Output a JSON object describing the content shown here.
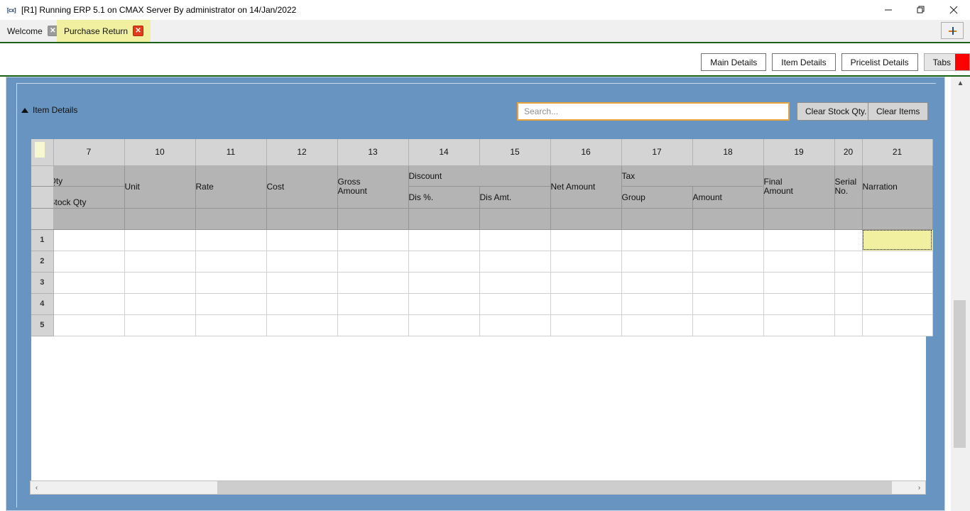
{
  "window": {
    "title": "[R1] Running ERP 5.1 on CMAX Server By administrator on 14/Jan/2022",
    "app_icon": "cmax-icon",
    "minimize_label": "—",
    "restore_label": "❐",
    "close_label": "✕"
  },
  "tabs": {
    "items": [
      {
        "label": "Welcome",
        "close": "✕",
        "active": false
      },
      {
        "label": "Purchase Return",
        "close": "✕",
        "active": true
      }
    ],
    "add_tab_label": "+"
  },
  "toolbar": {
    "buttons": [
      {
        "label": "Main Details",
        "active": false
      },
      {
        "label": "Item Details",
        "active": false
      },
      {
        "label": "Pricelist Details",
        "active": false
      },
      {
        "label": "Tabs",
        "active": true
      }
    ]
  },
  "section": {
    "title": "Item Details",
    "collapse_caret": "▲"
  },
  "search": {
    "placeholder": "Search...",
    "value": ""
  },
  "actions": {
    "clear_stock_qty": "Clear Stock Qty.",
    "clear_items": "Clear Items"
  },
  "grid": {
    "column_numbers": [
      "7",
      "10",
      "11",
      "12",
      "13",
      "14",
      "15",
      "16",
      "17",
      "18",
      "19",
      "20",
      "21"
    ],
    "group_headers": [
      {
        "label": "Qty",
        "span": 1
      },
      {
        "label": "Unit",
        "span": 1
      },
      {
        "label": "Rate",
        "span": 1
      },
      {
        "label": "Cost",
        "span": 1
      },
      {
        "label": "Gross Amount",
        "span": 1
      },
      {
        "label": "Discount",
        "span": 2
      },
      {
        "label": "Net Amount",
        "span": 1
      },
      {
        "label": "Tax",
        "span": 2
      },
      {
        "label": "Final Amount",
        "span": 1
      },
      {
        "label": "Serial No.",
        "span": 1
      },
      {
        "label": "Narration",
        "span": 1
      }
    ],
    "sub_headers": {
      "qty": "Stock Qty",
      "discount_pct": "Dis %.",
      "discount_amt": "Dis Amt.",
      "tax_group": "Group",
      "tax_amount": "Amount"
    },
    "header_cells": {
      "qty": "Qty",
      "unit": "Unit",
      "rate": "Rate",
      "cost": "Cost",
      "gross_amount_l1": "Gross",
      "gross_amount_l2": "Amount",
      "discount": "Discount",
      "net_amount": "Net Amount",
      "tax": "Tax",
      "final_amount_l1": "Final",
      "final_amount_l2": "Amount",
      "serial_no_l1": "Serial",
      "serial_no_l2": "No.",
      "narration": "Narration"
    },
    "row_numbers": [
      "1",
      "2",
      "3",
      "4",
      "5"
    ],
    "rows": [
      {
        "n": "1",
        "cells": [
          "",
          "",
          "",
          "",
          "",
          "",
          "",
          "",
          "",
          "",
          "",
          "",
          ""
        ]
      },
      {
        "n": "2",
        "cells": [
          "",
          "",
          "",
          "",
          "",
          "",
          "",
          "",
          "",
          "",
          "",
          "",
          ""
        ]
      },
      {
        "n": "3",
        "cells": [
          "",
          "",
          "",
          "",
          "",
          "",
          "",
          "",
          "",
          "",
          "",
          "",
          ""
        ]
      },
      {
        "n": "4",
        "cells": [
          "",
          "",
          "",
          "",
          "",
          "",
          "",
          "",
          "",
          "",
          "",
          "",
          ""
        ]
      },
      {
        "n": "5",
        "cells": [
          "",
          "",
          "",
          "",
          "",
          "",
          "",
          "",
          "",
          "",
          "",
          "",
          ""
        ]
      }
    ],
    "selected_cell": {
      "row": "1",
      "column": "21",
      "column_label": "Narration",
      "value": ""
    }
  },
  "scrollbars": {
    "h_left_arrow": "‹",
    "h_right_arrow": "›",
    "v_up_arrow": "▲"
  },
  "colors": {
    "panel_blue": "#6794c0",
    "active_tab_yellow": "#f1f0a0",
    "close_red": "#e03b1b",
    "accent_red": "#fe0000",
    "search_border": "#e8a33d",
    "green_rule": "#1c6118",
    "header_grey": "#b4b4b4",
    "colnum_grey": "#d4d4d4"
  }
}
